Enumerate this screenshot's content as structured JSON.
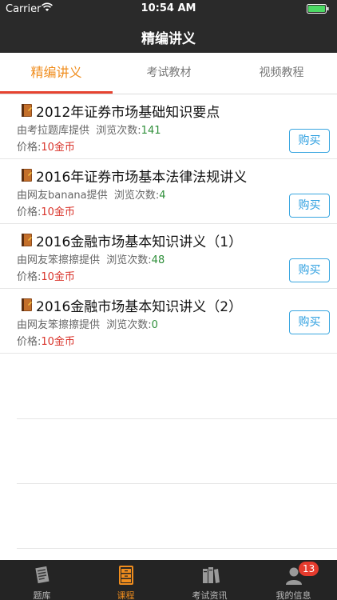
{
  "status_bar": {
    "carrier": "Carrier",
    "time": "10:54 AM"
  },
  "nav": {
    "title": "精编讲义"
  },
  "tabs": [
    {
      "label": "精编讲义",
      "active": true
    },
    {
      "label": "考试教材",
      "active": false
    },
    {
      "label": "视频教程",
      "active": false
    }
  ],
  "items": [
    {
      "title": "2012年证券市场基础知识要点",
      "provider": "由考拉题库提供",
      "views_label": "浏览次数:",
      "views": "141",
      "price_label": "价格:",
      "price": "10金币",
      "buy": "购买"
    },
    {
      "title": "2016年证券市场基本法律法规讲义",
      "provider": "由网友banana提供",
      "views_label": "浏览次数:",
      "views": "4",
      "price_label": "价格:",
      "price": "10金币",
      "buy": "购买"
    },
    {
      "title": "2016金融市场基本知识讲义（1）",
      "provider": "由网友笨擦擦提供",
      "views_label": "浏览次数:",
      "views": "48",
      "price_label": "价格:",
      "price": "10金币",
      "buy": "购买"
    },
    {
      "title": "2016金融市场基本知识讲义（2）",
      "provider": "由网友笨擦擦提供",
      "views_label": "浏览次数:",
      "views": "0",
      "price_label": "价格:",
      "price": "10金币",
      "buy": "购买"
    }
  ],
  "tabbar": [
    {
      "label": "题库",
      "icon": "document-icon",
      "active": false
    },
    {
      "label": "课程",
      "icon": "cabinet-icon",
      "active": true
    },
    {
      "label": "考试资讯",
      "icon": "books-icon",
      "active": false
    },
    {
      "label": "我的信息",
      "icon": "person-icon",
      "active": false,
      "badge": "13"
    }
  ],
  "colors": {
    "accent": "#f08d1d",
    "underline": "#e64330",
    "price": "#d9342b",
    "views": "#2f8f3a",
    "buy_border": "#3aa6e0"
  }
}
